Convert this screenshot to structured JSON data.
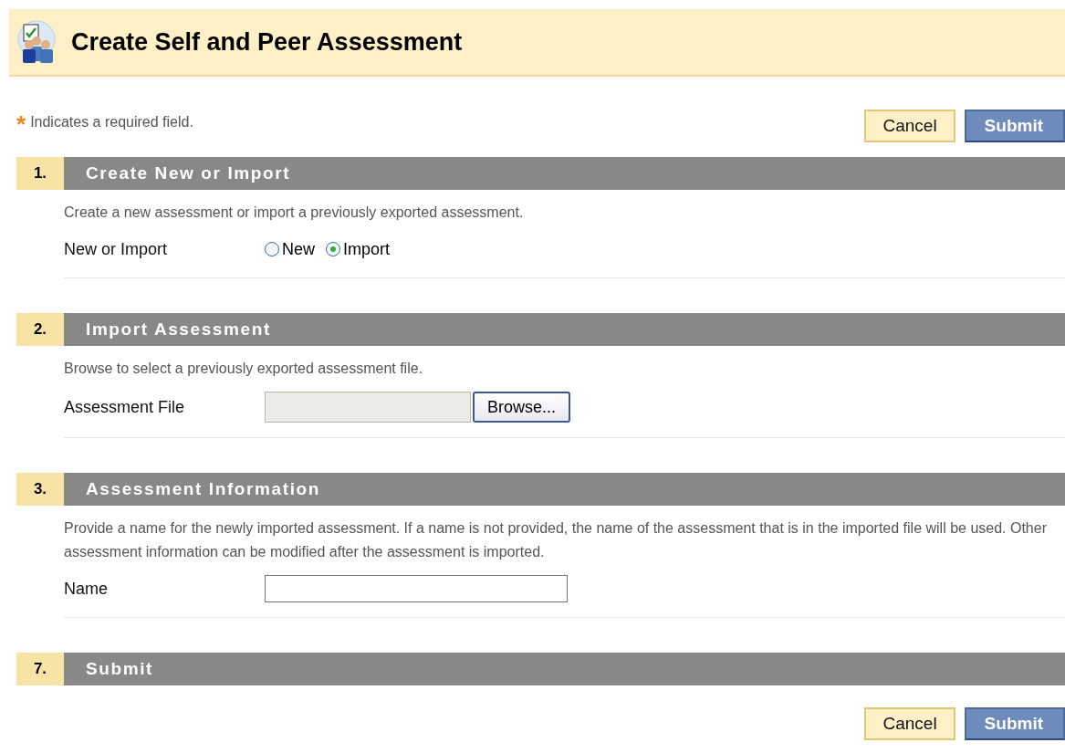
{
  "header": {
    "title": "Create Self and Peer Assessment"
  },
  "required_note": {
    "mark": "*",
    "text": "Indicates a required field."
  },
  "top_buttons": [
    {
      "label": "Cancel",
      "kind": "cancel"
    },
    {
      "label": "Submit",
      "kind": "submit"
    }
  ],
  "sections": [
    {
      "number": "1.",
      "title": "Create New or Import",
      "description": "Create a new assessment or import a previously exported assessment.",
      "field": {
        "kind": "radio",
        "label": "New or Import",
        "options": [
          {
            "label": "New",
            "selected": false
          },
          {
            "label": "Import",
            "selected": true
          }
        ]
      }
    },
    {
      "number": "2.",
      "title": "Import Assessment",
      "description": "Browse to select a previously exported assessment file.",
      "field": {
        "kind": "file",
        "label": "Assessment File",
        "button": "Browse..."
      }
    },
    {
      "number": "3.",
      "title": "Assessment Information",
      "description": "Provide a name for the newly imported assessment. If a name is not provided, the name of the assessment that is in the imported file will be used. Other assessment information can be modified after the assessment is imported.",
      "field": {
        "kind": "text",
        "label": "Name"
      }
    },
    {
      "number": "7.",
      "title": "Submit"
    }
  ],
  "bottom_buttons": [
    {
      "label": "Cancel",
      "kind": "cancel"
    },
    {
      "label": "Submit",
      "kind": "submit"
    }
  ]
}
